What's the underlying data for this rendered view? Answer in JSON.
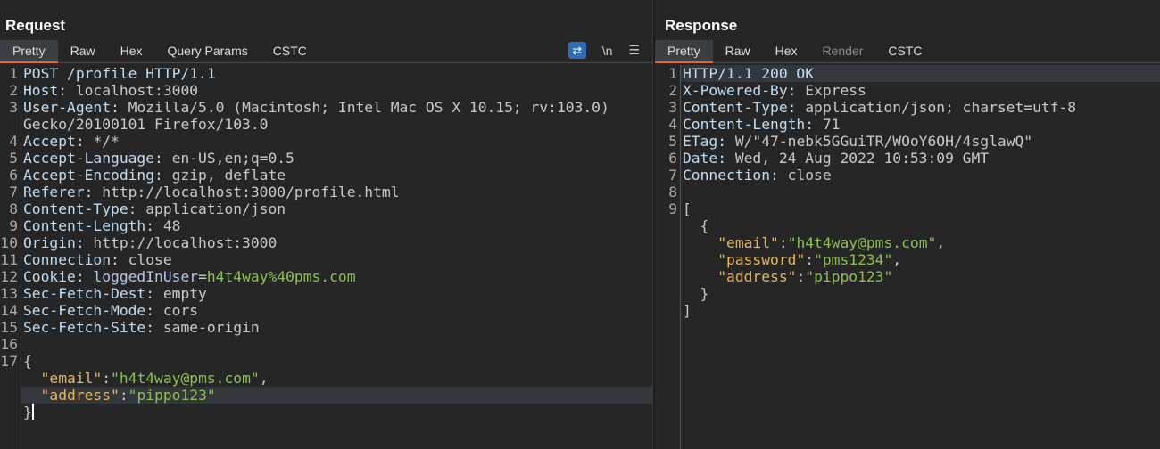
{
  "request": {
    "title": "Request",
    "tabs": [
      "Pretty",
      "Raw",
      "Hex",
      "Query Params",
      "CSTC"
    ],
    "active_tab": "Pretty",
    "tools": {
      "wrap_icon": "wrap-lines-icon",
      "newline_label": "\\n",
      "menu_icon": "menu-icon"
    },
    "highlight_line": 19,
    "lines": [
      {
        "n": "1",
        "s": [
          {
            "c": "k",
            "t": "POST /profile HTTP/1.1"
          }
        ]
      },
      {
        "n": "2",
        "s": [
          {
            "c": "k",
            "t": "Host: "
          },
          {
            "c": "v",
            "t": "localhost:3000"
          }
        ]
      },
      {
        "n": "3",
        "s": [
          {
            "c": "k",
            "t": "User-Agent: "
          },
          {
            "c": "v",
            "t": "Mozilla/5.0 (Macintosh; Intel Mac OS X 10.15; rv:103.0)"
          }
        ]
      },
      {
        "n": "",
        "s": [
          {
            "c": "v",
            "t": "Gecko/20100101 Firefox/103.0"
          }
        ]
      },
      {
        "n": "4",
        "s": [
          {
            "c": "k",
            "t": "Accept: "
          },
          {
            "c": "v",
            "t": "*/*"
          }
        ]
      },
      {
        "n": "5",
        "s": [
          {
            "c": "k",
            "t": "Accept-Language: "
          },
          {
            "c": "v",
            "t": "en-US,en;q=0.5"
          }
        ]
      },
      {
        "n": "6",
        "s": [
          {
            "c": "k",
            "t": "Accept-Encoding: "
          },
          {
            "c": "v",
            "t": "gzip, deflate"
          }
        ]
      },
      {
        "n": "7",
        "s": [
          {
            "c": "k",
            "t": "Referer: "
          },
          {
            "c": "v",
            "t": "http://localhost:3000/profile.html"
          }
        ]
      },
      {
        "n": "8",
        "s": [
          {
            "c": "k",
            "t": "Content-Type: "
          },
          {
            "c": "v",
            "t": "application/json"
          }
        ]
      },
      {
        "n": "9",
        "s": [
          {
            "c": "k",
            "t": "Content-Length: "
          },
          {
            "c": "v",
            "t": "48"
          }
        ]
      },
      {
        "n": "10",
        "s": [
          {
            "c": "k",
            "t": "Origin: "
          },
          {
            "c": "v",
            "t": "http://localhost:3000"
          }
        ]
      },
      {
        "n": "11",
        "s": [
          {
            "c": "k",
            "t": "Connection: "
          },
          {
            "c": "v",
            "t": "close"
          }
        ]
      },
      {
        "n": "12",
        "s": [
          {
            "c": "k",
            "t": "Cookie: "
          },
          {
            "c": "ck",
            "t": "loggedInUser"
          },
          {
            "c": "p",
            "t": "="
          },
          {
            "c": "js",
            "t": "h4t4way%40pms.com"
          }
        ]
      },
      {
        "n": "13",
        "s": [
          {
            "c": "k",
            "t": "Sec-Fetch-Dest: "
          },
          {
            "c": "v",
            "t": "empty"
          }
        ]
      },
      {
        "n": "14",
        "s": [
          {
            "c": "k",
            "t": "Sec-Fetch-Mode: "
          },
          {
            "c": "v",
            "t": "cors"
          }
        ]
      },
      {
        "n": "15",
        "s": [
          {
            "c": "k",
            "t": "Sec-Fetch-Site: "
          },
          {
            "c": "v",
            "t": "same-origin"
          }
        ]
      },
      {
        "n": "16",
        "s": []
      },
      {
        "n": "17",
        "s": [
          {
            "c": "p",
            "t": "{"
          }
        ]
      },
      {
        "n": "",
        "s": [
          {
            "c": "p",
            "t": "  "
          },
          {
            "c": "jk",
            "t": "\"email\""
          },
          {
            "c": "p",
            "t": ":"
          },
          {
            "c": "js",
            "t": "\"h4t4way@pms.com\""
          },
          {
            "c": "p",
            "t": ","
          }
        ]
      },
      {
        "n": "",
        "s": [
          {
            "c": "p",
            "t": "  "
          },
          {
            "c": "jk",
            "t": "\"address\""
          },
          {
            "c": "p",
            "t": ":"
          },
          {
            "c": "js",
            "t": "\"pippo123\""
          }
        ]
      },
      {
        "n": "",
        "s": [
          {
            "c": "p",
            "t": "}"
          }
        ],
        "cursor": true
      }
    ]
  },
  "response": {
    "title": "Response",
    "tabs": [
      "Pretty",
      "Raw",
      "Hex",
      "Render",
      "CSTC"
    ],
    "active_tab": "Pretty",
    "disabled_tabs": [
      "Render"
    ],
    "highlight_line": 0,
    "lines": [
      {
        "n": "1",
        "s": [
          {
            "c": "k",
            "t": "HTTP/1.1 200 OK"
          }
        ]
      },
      {
        "n": "2",
        "s": [
          {
            "c": "k",
            "t": "X-Powered-By: "
          },
          {
            "c": "v",
            "t": "Express"
          }
        ]
      },
      {
        "n": "3",
        "s": [
          {
            "c": "k",
            "t": "Content-Type: "
          },
          {
            "c": "v",
            "t": "application/json; charset=utf-8"
          }
        ]
      },
      {
        "n": "4",
        "s": [
          {
            "c": "k",
            "t": "Content-Length: "
          },
          {
            "c": "v",
            "t": "71"
          }
        ]
      },
      {
        "n": "5",
        "s": [
          {
            "c": "k",
            "t": "ETag: "
          },
          {
            "c": "v",
            "t": "W/\"47-nebk5GGuiTR/WOoY6OH/4sglawQ\""
          }
        ]
      },
      {
        "n": "6",
        "s": [
          {
            "c": "k",
            "t": "Date: "
          },
          {
            "c": "v",
            "t": "Wed, 24 Aug 2022 10:53:09 GMT"
          }
        ]
      },
      {
        "n": "7",
        "s": [
          {
            "c": "k",
            "t": "Connection: "
          },
          {
            "c": "v",
            "t": "close"
          }
        ]
      },
      {
        "n": "8",
        "s": []
      },
      {
        "n": "9",
        "s": [
          {
            "c": "p",
            "t": "["
          }
        ]
      },
      {
        "n": "",
        "s": [
          {
            "c": "p",
            "t": "  {"
          }
        ]
      },
      {
        "n": "",
        "s": [
          {
            "c": "p",
            "t": "    "
          },
          {
            "c": "jk",
            "t": "\"email\""
          },
          {
            "c": "p",
            "t": ":"
          },
          {
            "c": "js",
            "t": "\"h4t4way@pms.com\""
          },
          {
            "c": "p",
            "t": ","
          }
        ]
      },
      {
        "n": "",
        "s": [
          {
            "c": "p",
            "t": "    "
          },
          {
            "c": "jk",
            "t": "\"password\""
          },
          {
            "c": "p",
            "t": ":"
          },
          {
            "c": "js",
            "t": "\"pms1234\""
          },
          {
            "c": "p",
            "t": ","
          }
        ]
      },
      {
        "n": "",
        "s": [
          {
            "c": "p",
            "t": "    "
          },
          {
            "c": "jk",
            "t": "\"address\""
          },
          {
            "c": "p",
            "t": ":"
          },
          {
            "c": "js",
            "t": "\"pippo123\""
          }
        ]
      },
      {
        "n": "",
        "s": [
          {
            "c": "p",
            "t": "  }"
          }
        ]
      },
      {
        "n": "",
        "s": [
          {
            "c": "p",
            "t": "]"
          }
        ]
      }
    ]
  }
}
